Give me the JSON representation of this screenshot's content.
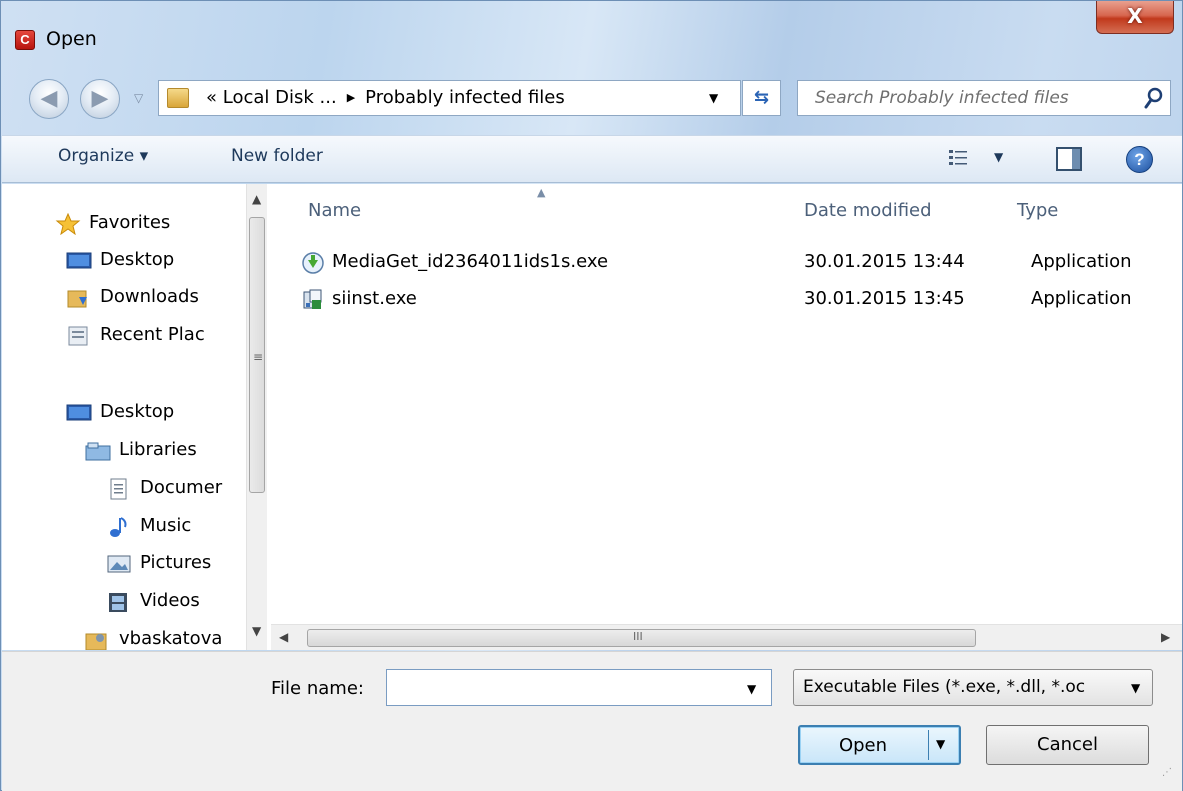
{
  "window": {
    "title": "Open",
    "app_icon_letter": "C",
    "close_label": "X"
  },
  "navigation": {
    "address": {
      "prefix": "«",
      "parent": "Local Disk ...",
      "current": "Probably infected files"
    },
    "search_placeholder": "Search Probably infected files"
  },
  "commandbar": {
    "organize_label": "Organize ▾",
    "new_folder_label": "New folder",
    "help_label": "?"
  },
  "sidebar": {
    "items": [
      {
        "label": "Favorites",
        "icon": "star-icon"
      },
      {
        "label": "Desktop",
        "icon": "desktop-icon"
      },
      {
        "label": "Downloads",
        "icon": "downloads-icon"
      },
      {
        "label": "Recent Plac",
        "icon": "recent-places-icon"
      },
      {
        "label": "Desktop",
        "icon": "desktop-icon"
      },
      {
        "label": "Libraries",
        "icon": "libraries-icon"
      },
      {
        "label": "Documer",
        "icon": "documents-icon"
      },
      {
        "label": "Music",
        "icon": "music-icon"
      },
      {
        "label": "Pictures",
        "icon": "pictures-icon"
      },
      {
        "label": "Videos",
        "icon": "videos-icon"
      },
      {
        "label": "vbaskatova",
        "icon": "user-folder-icon"
      }
    ]
  },
  "files": {
    "columns": {
      "name": "Name",
      "date": "Date modified",
      "type": "Type"
    },
    "rows": [
      {
        "name": "MediaGet_id2364011ids1s.exe",
        "date": "30.01.2015 13:44",
        "type": "Application",
        "icon": "mediaget-icon"
      },
      {
        "name": "siinst.exe",
        "date": "30.01.2015 13:45",
        "type": "Application",
        "icon": "installer-icon"
      }
    ],
    "hscroll_grip": "III"
  },
  "bottom": {
    "file_name_label": "File name:",
    "file_name_value": "",
    "file_type_selected": "Executable Files (*.exe, *.dll, *.oc",
    "open_label": "Open",
    "cancel_label": "Cancel"
  }
}
